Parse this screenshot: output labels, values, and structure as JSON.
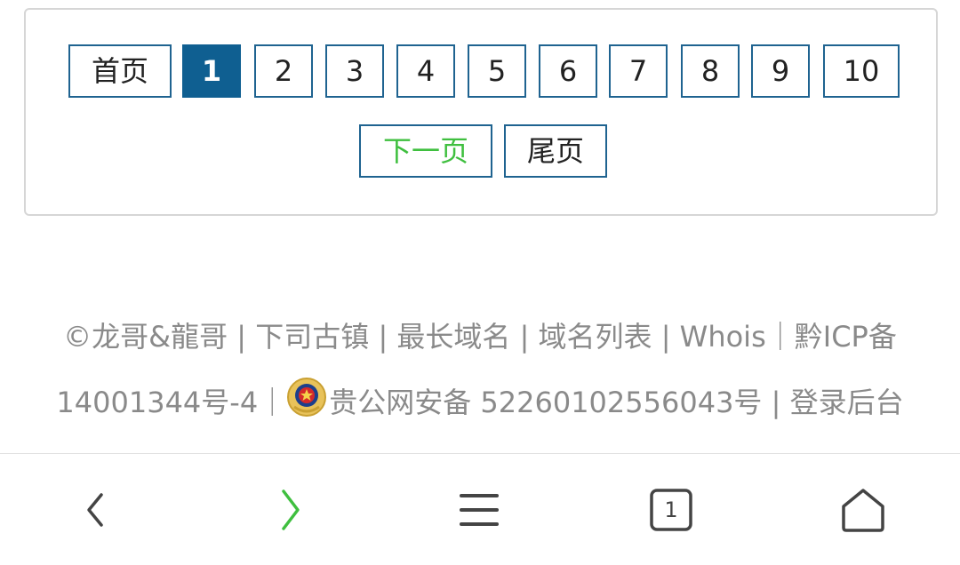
{
  "pagination": {
    "first_label": "首页",
    "pages": [
      "1",
      "2",
      "3",
      "4",
      "5",
      "6",
      "7",
      "8",
      "9",
      "10"
    ],
    "current_page": "1",
    "next_label": "下一页",
    "last_label": "尾页",
    "colors": {
      "border": "#1f6390",
      "current_bg": "#0f5f91",
      "next_text": "#3fbf3f"
    }
  },
  "footer": {
    "copyright": "©龙哥&龍哥",
    "links": [
      "下司古镇",
      "最长域名",
      "域名列表",
      "Whois"
    ],
    "separator": "|",
    "full_separator": "｜",
    "icp_line1": "黔ICP备",
    "icp_line2": "14001344号-4",
    "police_record": "贵公网安备 52260102556043号",
    "admin_link": "登录后台",
    "text_color": "#8a8a8a"
  },
  "browser_nav": {
    "tab_count": "1",
    "icons": [
      "back-icon",
      "forward-icon",
      "menu-icon",
      "tabs-icon",
      "home-icon"
    ],
    "active_color": "#3fbf3f"
  }
}
